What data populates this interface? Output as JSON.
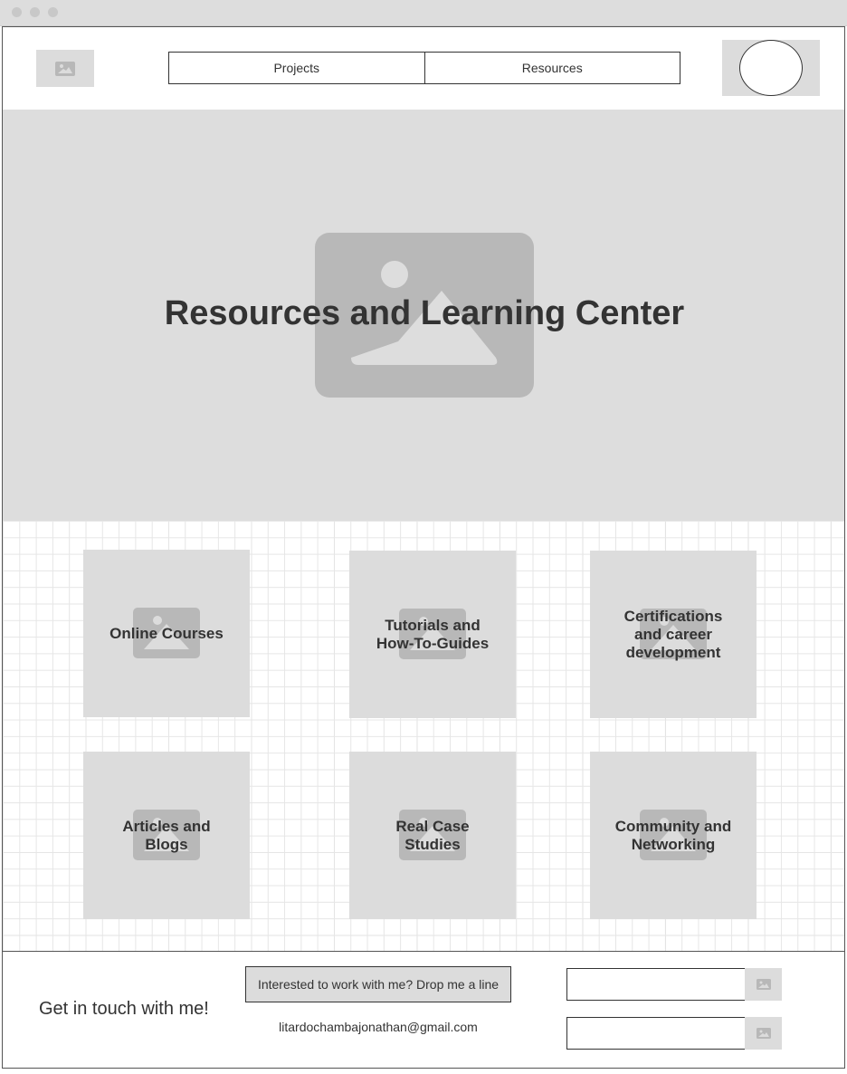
{
  "window": {
    "controls": [
      "close",
      "minimize",
      "maximize"
    ]
  },
  "header": {
    "logo_icon": "image-placeholder-icon",
    "nav": [
      {
        "label": "Projects"
      },
      {
        "label": "Resources"
      }
    ],
    "avatar_icon": "avatar-circle"
  },
  "hero": {
    "title": "Resources and Learning Center",
    "background_icon": "image-placeholder-icon"
  },
  "cards": [
    {
      "label": "Online Courses",
      "icon": "image-placeholder-icon"
    },
    {
      "label": "Tutorials and\nHow-To-Guides",
      "icon": "image-placeholder-icon"
    },
    {
      "label": "Certifications\nand career\ndevelopment",
      "icon": "image-placeholder-icon"
    },
    {
      "label": "Articles and\nBlogs",
      "icon": "image-placeholder-icon"
    },
    {
      "label": "Real Case\nStudies",
      "icon": "image-placeholder-icon"
    },
    {
      "label": "Community and\nNetworking",
      "icon": "image-placeholder-icon"
    }
  ],
  "footer": {
    "heading": "Get in touch with me!",
    "cta_label": "Interested to work with me? Drop me a line",
    "email": "litardochambajonathan@gmail.com",
    "fields": [
      {
        "value": "",
        "button_icon": "image-placeholder-icon"
      },
      {
        "value": "",
        "button_icon": "image-placeholder-icon"
      }
    ]
  },
  "colors": {
    "placeholder_fill": "#dcdcdc",
    "placeholder_icon": "#b8b8b8",
    "border": "#333333",
    "text": "#333333"
  }
}
